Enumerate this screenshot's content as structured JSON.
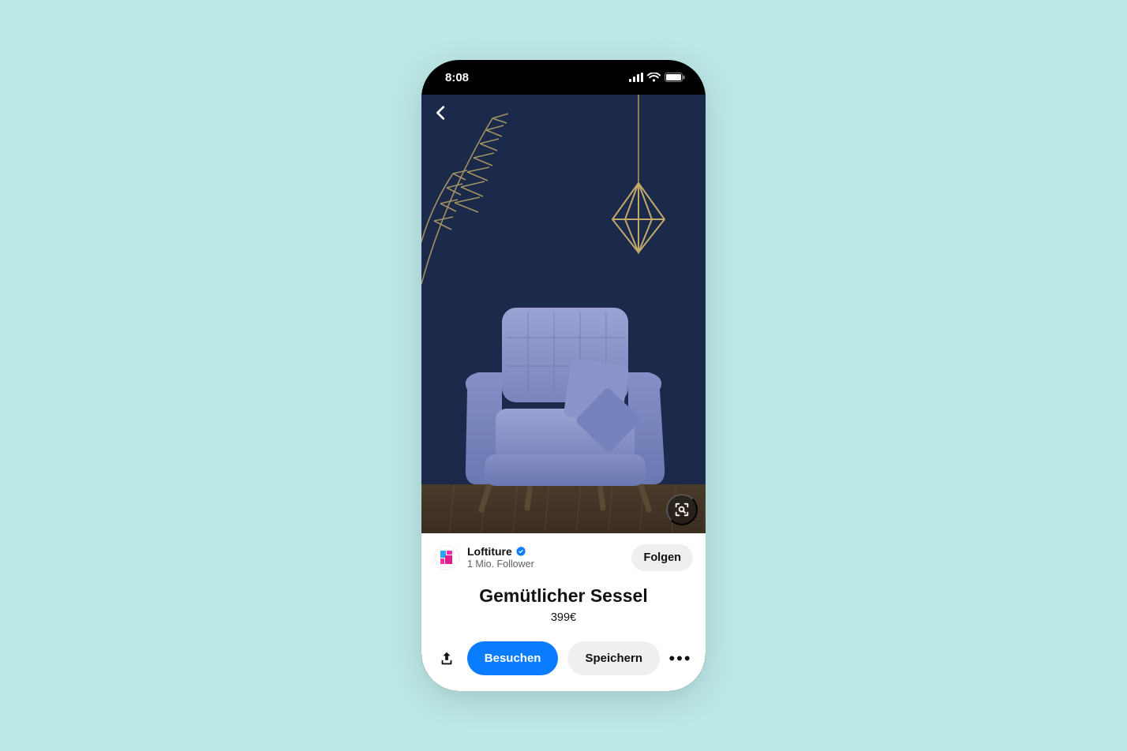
{
  "status": {
    "time": "8:08"
  },
  "creator": {
    "name": "Loftiture",
    "followers": "1 Mio. Follower",
    "follow_label": "Folgen"
  },
  "product": {
    "title": "Gemütlicher Sessel",
    "price": "399€"
  },
  "actions": {
    "visit": "Besuchen",
    "save": "Speichern"
  },
  "colors": {
    "accent": "#0a7cff",
    "wall": "#1b2a4a",
    "chair": "#8590c8"
  }
}
